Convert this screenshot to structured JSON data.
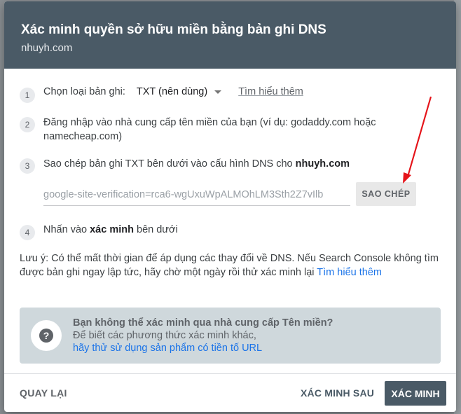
{
  "dialog": {
    "title": "Xác minh quyền sở hữu miền bằng bản ghi DNS",
    "subtitle": "nhuyh.com"
  },
  "steps": [
    {
      "num": "1",
      "label": "Chọn loại bản ghi:",
      "select_value": "TXT (nên dùng)",
      "learn_more": "Tìm hiểu thêm"
    },
    {
      "num": "2",
      "text": "Đăng nhập vào nhà cung cấp tên miền của bạn (ví dụ: godaddy.com hoặc namecheap.com)"
    },
    {
      "num": "3",
      "text_prefix": "Sao chép bản ghi TXT bên dưới vào cấu hình DNS cho",
      "domain": "nhuyh.com"
    },
    {
      "num": "4",
      "text_prefix": "Nhấn vào",
      "bold": "xác minh",
      "text_suffix": "bên dưới"
    }
  ],
  "token": {
    "value": "google-site-verification=rca6-wgUxuWpALMOhLM3Sth2Z7vIlb",
    "copy_label": "SAO CHÉP"
  },
  "note": {
    "text": "Lưu ý: Có thể mất thời gian để áp dụng các thay đổi về DNS. Nếu Search Console không tìm được bản ghi ngay lập tức, hãy chờ một ngày rồi thử xác minh lại",
    "link": "Tìm hiểu thêm"
  },
  "help": {
    "title": "Bạn không thể xác minh qua nhà cung cấp Tên miền?",
    "line": "Để biết các phương thức xác minh khác,",
    "link": "hãy thử sử dụng sản phẩm có tiền tố URL",
    "icon": "?"
  },
  "footer": {
    "back": "QUAY LẠI",
    "later": "XÁC MINH SAU",
    "verify": "XÁC MINH"
  },
  "colors": {
    "header": "#4a5a66",
    "link": "#1a73e8",
    "arrow": "#e5141a"
  }
}
